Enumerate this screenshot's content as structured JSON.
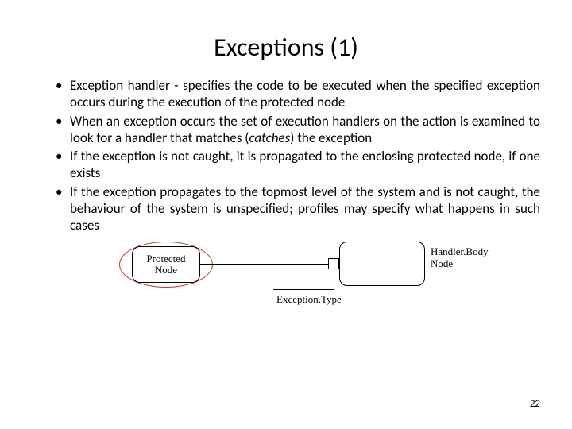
{
  "title": "Exceptions (1)",
  "bullets": {
    "b1a": "Exception handler - specifies the code to be executed when the specified exception occurs during the execution of the protected node",
    "b2a": "When an exception occurs the set of execution handlers on the action is examined to look for a handler that matches (",
    "b2b": "catches",
    "b2c": ") the exception",
    "b3a": "If the exception is not caught, it is propagated to the enclosing protected node, if one exists",
    "b4a": "If the exception propagates to the topmost level of the system and is not caught, the behaviour of the system is unspecified; profiles may specify what happens in such cases"
  },
  "diagram": {
    "protected_node_l1": "Protected",
    "protected_node_l2": "Node",
    "handler_l1": "Handler.Body",
    "handler_l2": "Node",
    "exception_type": "Exception.Type"
  },
  "page_number": "22"
}
